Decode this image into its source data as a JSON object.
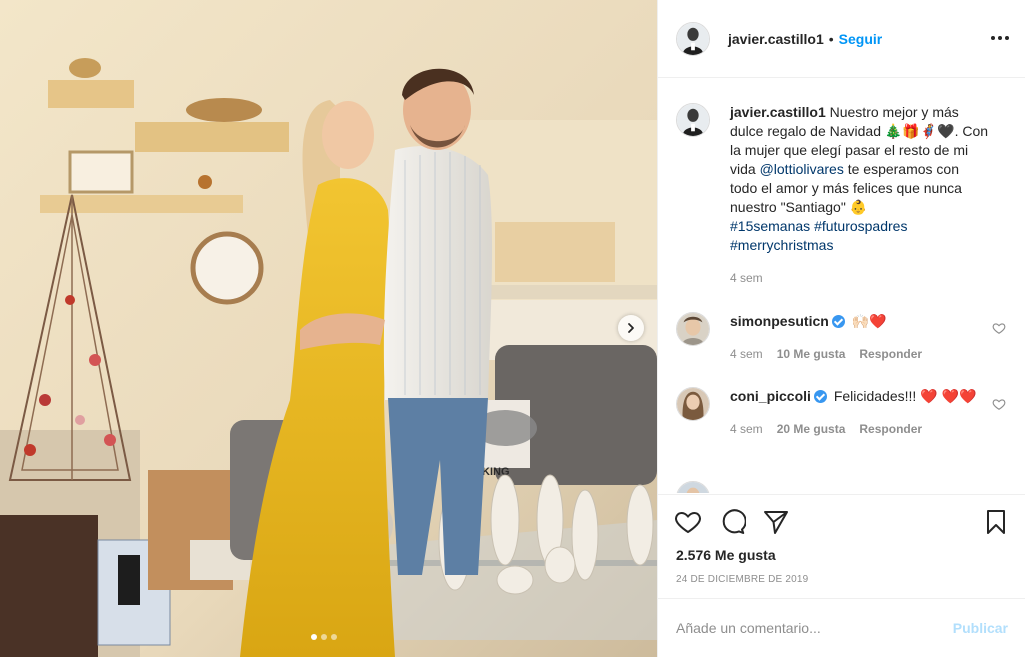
{
  "post": {
    "carousel": {
      "slide_count": 3,
      "active_slide": 1
    },
    "colors": {
      "link": "#00376b",
      "accent": "#0095f6",
      "publish_disabled": "#b2dffc",
      "like_heart": "#ed4956"
    }
  },
  "header": {
    "username": "javier.castillo1",
    "separator": "•",
    "follow_label": "Seguir"
  },
  "caption": {
    "username": "javier.castillo1",
    "text_1": " Nuestro mejor y más dulce regalo de Navidad 🎄🎁🦸🖤. Con la mujer que elegí pasar el resto de mi vida ",
    "mention": "@lottiolivares",
    "text_2": " te esperamos con todo el amor y más felices que nunca nuestro \"Santiago\" 👶",
    "tags": [
      "#15semanas",
      "#futurospadres",
      "#merrychristmas"
    ],
    "time": "4 sem"
  },
  "comments": [
    {
      "username": "simonpesuticn",
      "text": "🙌🏻❤️",
      "time": "4 sem",
      "likes": "10 Me gusta",
      "reply": "Responder"
    },
    {
      "username": "coni_piccoli",
      "text": "Felicidades!!! ❤️ ❤️❤️",
      "time": "4 sem",
      "likes": "20 Me gusta",
      "reply": "Responder"
    },
    {
      "username": "",
      "text": ""
    }
  ],
  "actions": {
    "likes": "2.576 Me gusta",
    "date": "24 de diciembre de 2019",
    "icons": [
      "heart-icon",
      "comment-icon",
      "share-icon",
      "bookmark-icon"
    ]
  },
  "add_comment": {
    "placeholder": "Añade un comentario...",
    "publish_label": "Publicar"
  }
}
